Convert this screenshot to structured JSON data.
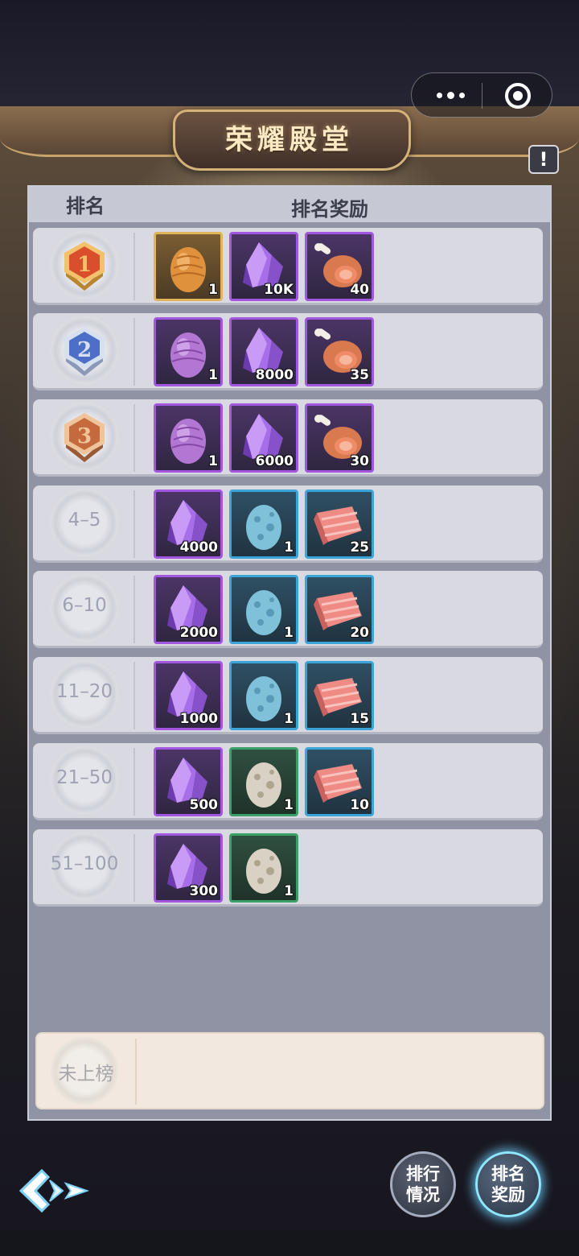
{
  "header": {
    "title": "荣耀殿堂",
    "info_icon": "exclamation-icon",
    "capsule": {
      "menu_icon": "more-dots-icon",
      "close_icon": "target-circle-icon"
    }
  },
  "table": {
    "head_rank": "排名",
    "head_reward": "排名奖励",
    "rows": [
      {
        "rank": "1",
        "medal": "gold-medal-icon",
        "items": [
          {
            "icon": "orange-egg-icon",
            "rarity": "gold",
            "count": "1"
          },
          {
            "icon": "purple-crystal-icon",
            "rarity": "purple",
            "count": "10K"
          },
          {
            "icon": "meat-leg-icon",
            "rarity": "purple",
            "count": "40"
          }
        ]
      },
      {
        "rank": "2",
        "medal": "silver-medal-icon",
        "items": [
          {
            "icon": "purple-egg-icon",
            "rarity": "purple",
            "count": "1"
          },
          {
            "icon": "purple-crystal-icon",
            "rarity": "purple",
            "count": "8000"
          },
          {
            "icon": "meat-leg-icon",
            "rarity": "purple",
            "count": "35"
          }
        ]
      },
      {
        "rank": "3",
        "medal": "bronze-medal-icon",
        "items": [
          {
            "icon": "purple-egg-icon",
            "rarity": "purple",
            "count": "1"
          },
          {
            "icon": "purple-crystal-icon",
            "rarity": "purple",
            "count": "6000"
          },
          {
            "icon": "meat-leg-icon",
            "rarity": "purple",
            "count": "30"
          }
        ]
      },
      {
        "rank": "4–5",
        "items": [
          {
            "icon": "purple-crystal-icon",
            "rarity": "purple",
            "count": "4000"
          },
          {
            "icon": "blue-spotted-egg-icon",
            "rarity": "blue",
            "count": "1"
          },
          {
            "icon": "raw-meat-slab-icon",
            "rarity": "blue",
            "count": "25"
          }
        ]
      },
      {
        "rank": "6–10",
        "items": [
          {
            "icon": "purple-crystal-icon",
            "rarity": "purple",
            "count": "2000"
          },
          {
            "icon": "blue-spotted-egg-icon",
            "rarity": "blue",
            "count": "1"
          },
          {
            "icon": "raw-meat-slab-icon",
            "rarity": "blue",
            "count": "20"
          }
        ]
      },
      {
        "rank": "11–20",
        "items": [
          {
            "icon": "purple-crystal-icon",
            "rarity": "purple",
            "count": "1000"
          },
          {
            "icon": "blue-spotted-egg-icon",
            "rarity": "blue",
            "count": "1"
          },
          {
            "icon": "raw-meat-slab-icon",
            "rarity": "blue",
            "count": "15"
          }
        ]
      },
      {
        "rank": "21–50",
        "items": [
          {
            "icon": "purple-crystal-icon",
            "rarity": "purple",
            "count": "500"
          },
          {
            "icon": "white-spotted-egg-icon",
            "rarity": "green",
            "count": "1"
          },
          {
            "icon": "raw-meat-slab-icon",
            "rarity": "blue",
            "count": "10"
          }
        ]
      },
      {
        "rank": "51–100",
        "items": [
          {
            "icon": "purple-crystal-icon",
            "rarity": "purple",
            "count": "300"
          },
          {
            "icon": "white-spotted-egg-icon",
            "rarity": "green",
            "count": "1"
          }
        ]
      }
    ]
  },
  "self": {
    "rank": "未上榜"
  },
  "footer": {
    "back_icon": "back-arrow-icon",
    "ranking_button": "排行\n情况",
    "ranking_button_l1": "排行",
    "ranking_button_l2": "情况",
    "reward_button_l1": "排名",
    "reward_button_l2": "奖励"
  },
  "colors": {
    "gold": "#e0b45a",
    "purple": "#a357e0",
    "blue": "#3aa5d6",
    "green": "#3aa067",
    "panel": "#8f93a3",
    "row": "#d9dae1",
    "self_row": "#f2e8df"
  }
}
